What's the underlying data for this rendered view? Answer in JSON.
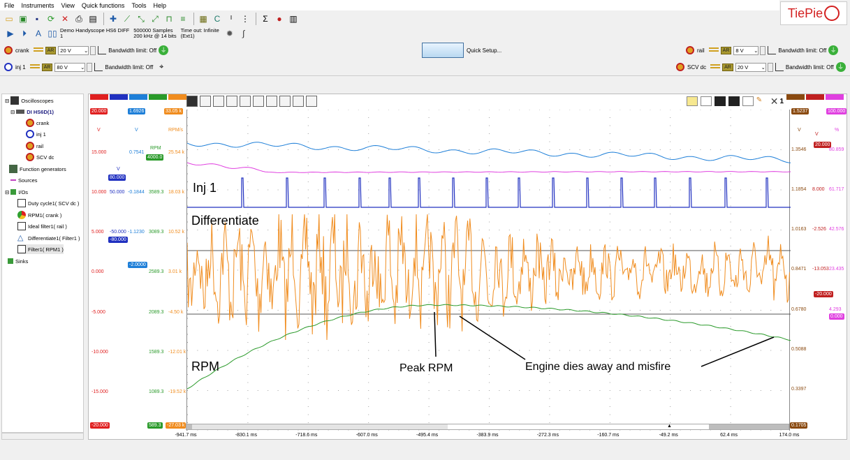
{
  "menu": [
    "File",
    "Instruments",
    "View",
    "Quick functions",
    "Tools",
    "Help"
  ],
  "brand": "TiePie",
  "instrument": {
    "name_line1": "Demo Handyscope HS6 DIFF",
    "name_line2": "1",
    "samples_line1": "500000 Samples",
    "samples_line2": "200 kHz @ 14 bits",
    "timeout_line1": "Time out: Infinite",
    "timeout_line2": "(Ext1)"
  },
  "channels": {
    "crank": {
      "name": "crank",
      "range": "20 V",
      "bw": "Bandwidth limit: Off"
    },
    "inj1": {
      "name": "inj 1",
      "range": "80 V",
      "bw": "Bandwidth limit: Off"
    },
    "rail": {
      "name": "rail",
      "range": "8 V",
      "bw": "Bandwidth limit: Off"
    },
    "scv": {
      "name": "SCV dc",
      "range": "20 V",
      "bw": "Bandwidth limit: Off"
    }
  },
  "ar_label": "AR",
  "quick_setup": "Quick Setup...",
  "tree": {
    "oscilloscopes": "Oscilloscopes",
    "device": "DI HS6D(1)",
    "ch1": "crank",
    "ch2": "inj 1",
    "ch3": "rail",
    "ch4": "SCV dc",
    "generators": "Function generators",
    "sources": "Sources",
    "ios": "I/Os",
    "f1": "Duty cycle1( SCV dc )",
    "f2": "RPM1( crank )",
    "f3": "Ideal filter1( rail )",
    "f4": "Differentiate1( Filter1 )",
    "f5": "Filter1( RPM1 )",
    "sinks": "Sinks"
  },
  "left_axes": {
    "col1": {
      "top": "20.000",
      "unit": "V",
      "ticks": [
        "15.000",
        "10.000",
        "5.000",
        "0.000",
        "-5.000",
        "-10.000",
        "-15.000"
      ],
      "bottom": "-20.000"
    },
    "col2": {
      "top": "1.6926",
      "unit": "V",
      "ticks": [
        "0.7541",
        "50.000",
        "-50.000",
        "-2.0000"
      ],
      "badge_a": "80.000",
      "badge_b": "-80.000",
      "unit_b": "V"
    },
    "col3": {
      "ticks": [
        "-0.1844",
        "-1.1230"
      ]
    },
    "col4": {
      "unit": "RPM",
      "badge": "4000.0",
      "ticks": [
        "3589.3",
        "3089.3",
        "2589.3",
        "2089.3",
        "1589.3",
        "1089.3"
      ],
      "bottom": "589.3"
    },
    "col5": {
      "top": "33.05 k",
      "unit": "RPM/s",
      "ticks": [
        "25.54 k",
        "18.03 k",
        "10.52 k",
        "3.01 k",
        "-4.50 k",
        "-12.01 k",
        "-19.52 k"
      ],
      "bottom": "-27.03 k"
    }
  },
  "right_axes": {
    "col1": {
      "top": "1.5237",
      "unit": "V",
      "ticks": [
        "1.3546",
        "1.1854",
        "1.0163",
        "0.8471",
        "0.6780",
        "0.5088",
        "0.3397"
      ],
      "bottom": "0.1705"
    },
    "col2": {
      "unit": "V",
      "badge_a": "20.000",
      "ticks": [
        "8.000",
        "-2.526",
        "-13.053"
      ],
      "badge_b": "-20.000"
    },
    "col3": {
      "top": "100.000",
      "unit": "%",
      "ticks": [
        "80.859",
        "61.717",
        "42.576",
        "23.435",
        "4.293"
      ],
      "badge": "0.000"
    }
  },
  "x_ticks": [
    "-941.7 ms",
    "-830.1 ms",
    "-718.6 ms",
    "-607.0 ms",
    "-495.4 ms",
    "-383.9 ms",
    "-272.3 ms",
    "-160.7 ms",
    "-49.2 ms",
    "62.4 ms",
    "174.0 ms"
  ],
  "annotations": {
    "inj": "Inj 1",
    "diff": "Differentiate",
    "rpm": "RPM",
    "peak": "Peak RPM",
    "engine": "Engine dies away and misfire"
  },
  "graph_count": "1",
  "colors": {
    "blue": "#1e7fd8",
    "magenta": "#e040e0",
    "navy": "#2030c0",
    "orange": "#f08c1e",
    "green": "#2a9a2a"
  }
}
